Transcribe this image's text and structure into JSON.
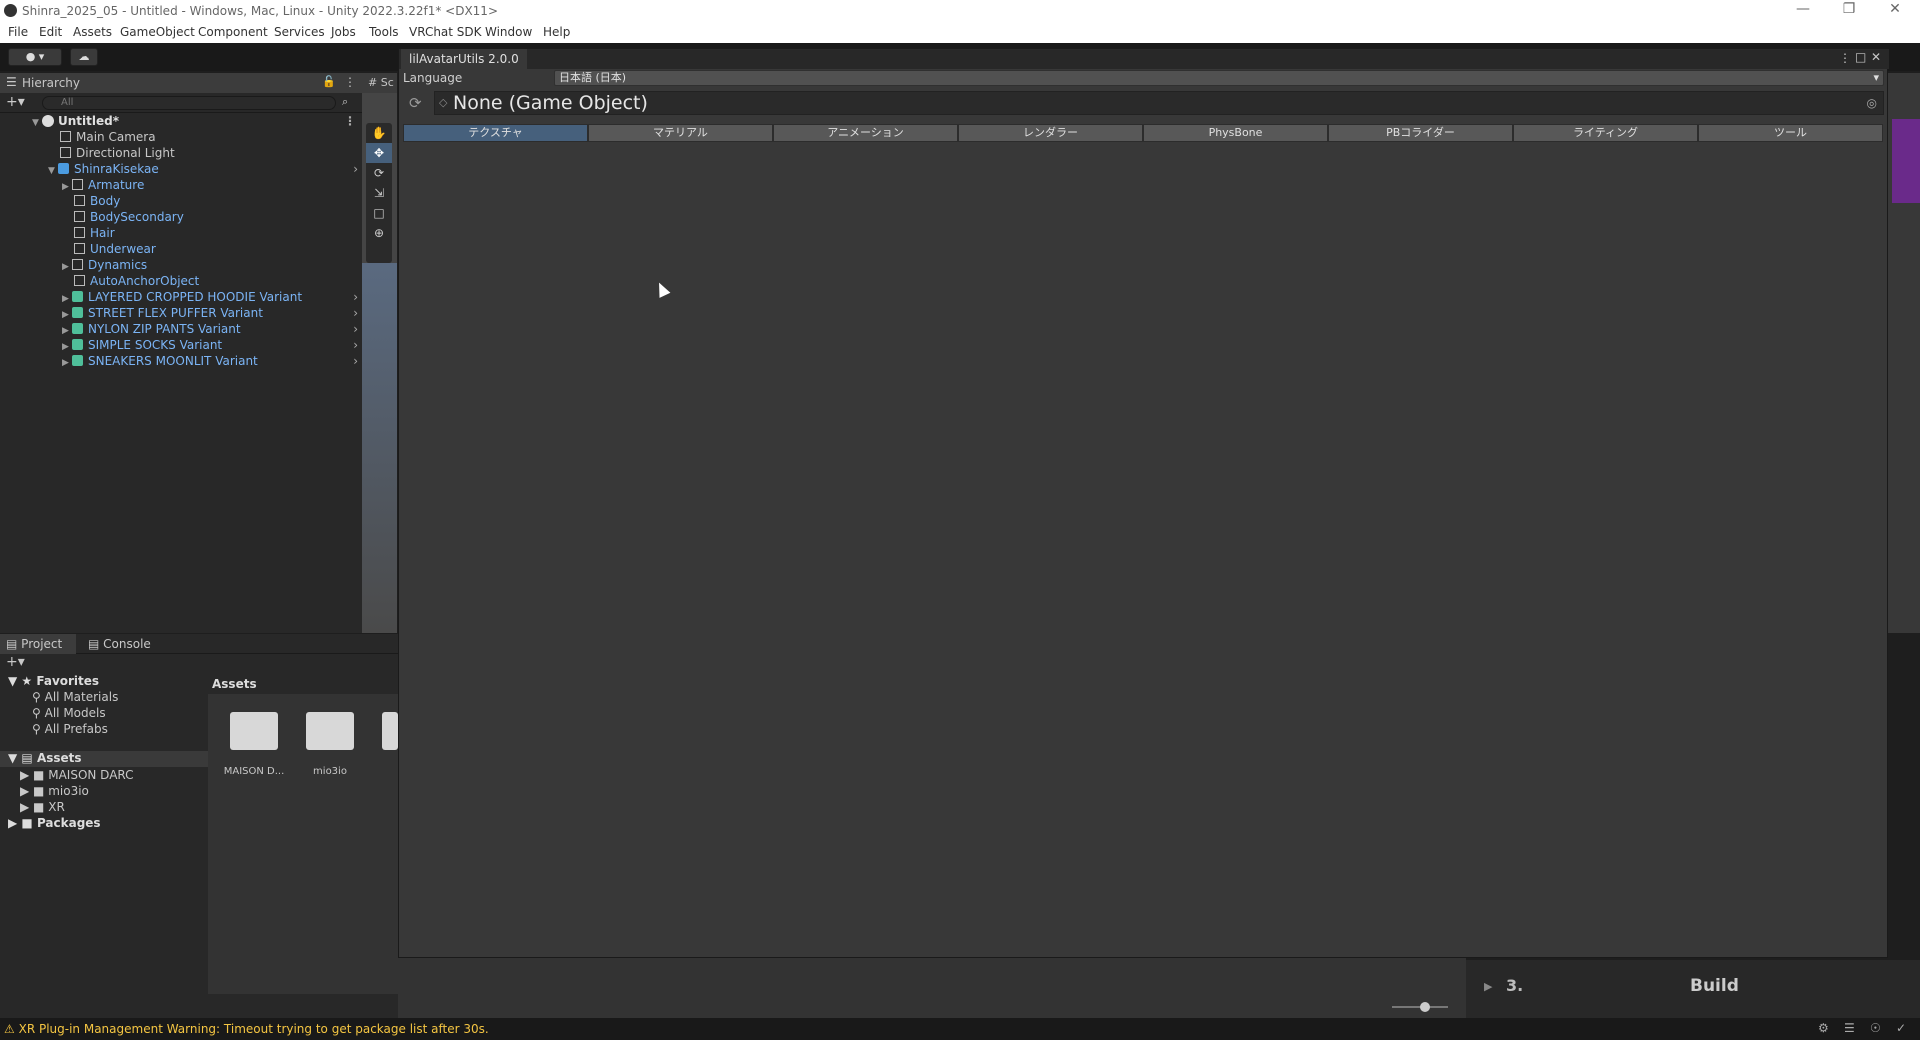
{
  "titlebar": {
    "title": "Shinra_2025_05 - Untitled - Windows, Mac, Linux - Unity 2022.3.22f1* <DX11>"
  },
  "menu": [
    "File",
    "Edit",
    "Assets",
    "GameObject",
    "Component",
    "Services",
    "Jobs",
    "Tools",
    "VRChat SDK",
    "Window",
    "Help"
  ],
  "hierarchy": {
    "tab": "Hierarchy",
    "search_placeholder": "All",
    "scene": "Untitled*",
    "items": [
      {
        "label": "Main Camera"
      },
      {
        "label": "Directional Light"
      },
      {
        "label": "ShinraKisekae"
      },
      {
        "label": "Armature"
      },
      {
        "label": "Body"
      },
      {
        "label": "BodySecondary"
      },
      {
        "label": "Hair"
      },
      {
        "label": "Underwear"
      },
      {
        "label": "Dynamics"
      },
      {
        "label": "AutoAnchorObject"
      },
      {
        "label": "LAYERED CROPPED HOODIE Variant"
      },
      {
        "label": "STREET FLEX PUFFER Variant"
      },
      {
        "label": "NYLON ZIP PANTS Variant"
      },
      {
        "label": "SIMPLE SOCKS Variant"
      },
      {
        "label": "SNEAKERS MOONLIT Variant"
      }
    ]
  },
  "scene_tab": "Sc",
  "tool": {
    "title": "lilAvatarUtils 2.0.0",
    "language_label": "Language",
    "language_value": "日本語 (日本)",
    "object_field": "None (Game Object)",
    "tabs": [
      "テクスチャ",
      "マテリアル",
      "アニメーション",
      "レンダラー",
      "PhysBone",
      "PBコライダー",
      "ライティング",
      "ツール"
    ]
  },
  "project": {
    "tabs": [
      "Project",
      "Console"
    ],
    "favorites": "Favorites",
    "fav_items": [
      "All Materials",
      "All Models",
      "All Prefabs"
    ],
    "assets": "Assets",
    "asset_folders": [
      "MAISON DARC",
      "mio3io",
      "XR"
    ],
    "packages": "Packages",
    "grid_header": "Assets",
    "grid_items": [
      "MAISON D...",
      "mio3io"
    ]
  },
  "build": {
    "step": "3.",
    "label": "Build"
  },
  "status": {
    "warning": "XR Plug-in Management Warning: Timeout trying to get package list after 30s."
  }
}
